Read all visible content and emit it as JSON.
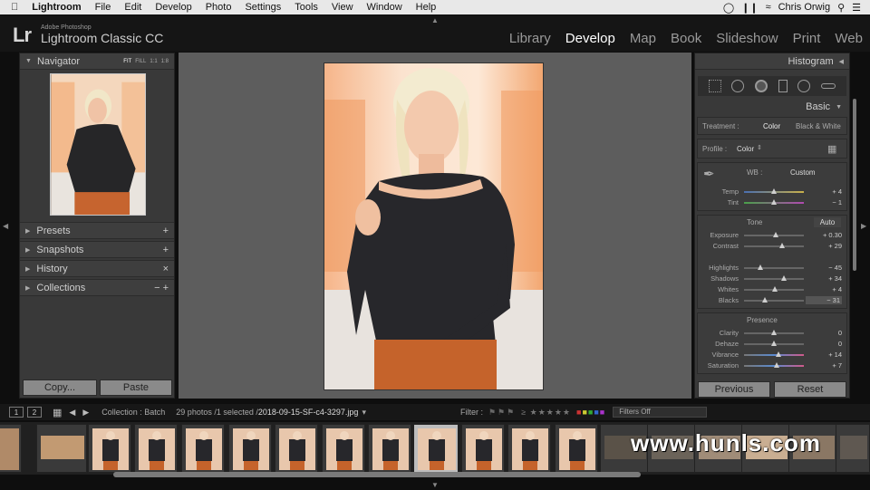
{
  "menubar": {
    "apple": "",
    "app_name": "Lightroom",
    "items": [
      "File",
      "Edit",
      "Develop",
      "Photo",
      "Settings",
      "Tools",
      "View",
      "Window",
      "Help"
    ],
    "user": "Chris Orwig"
  },
  "identity": {
    "logo": "Lr",
    "company": "Adobe Photoshop",
    "product": "Lightroom Classic CC",
    "modules": [
      "Library",
      "Develop",
      "Map",
      "Book",
      "Slideshow",
      "Print",
      "Web"
    ],
    "active_module": "Develop"
  },
  "left_panel": {
    "navigator": {
      "title": "Navigator",
      "zoom_options": [
        "FIT",
        "FILL",
        "1:1",
        "1:8"
      ],
      "active_zoom": "FIT"
    },
    "sections": [
      {
        "label": "Presets",
        "action": "+"
      },
      {
        "label": "Snapshots",
        "action": "+"
      },
      {
        "label": "History",
        "action": "×"
      },
      {
        "label": "Collections",
        "action": "−  +"
      }
    ],
    "copy_button": "Copy...",
    "paste_button": "Paste"
  },
  "right_panel": {
    "histogram_title": "Histogram",
    "basic_title": "Basic",
    "treatment_label": "Treatment :",
    "treatment_color": "Color",
    "treatment_bw": "Black & White",
    "profile_label": "Profile :",
    "profile_value": "Color",
    "wb_label": "WB :",
    "wb_value": "Custom",
    "tone_label": "Tone",
    "auto_label": "Auto",
    "presence_label": "Presence",
    "sliders": [
      {
        "label": "Temp",
        "value": "+ 4",
        "pos": 0.5
      },
      {
        "label": "Tint",
        "value": "− 1",
        "pos": 0.5
      },
      {
        "label": "Exposure",
        "value": "+ 0.30",
        "pos": 0.53
      },
      {
        "label": "Contrast",
        "value": "+ 29",
        "pos": 0.64
      },
      {
        "label": "Highlights",
        "value": "− 45",
        "pos": 0.28
      },
      {
        "label": "Shadows",
        "value": "+ 34",
        "pos": 0.67
      },
      {
        "label": "Whites",
        "value": "+ 4",
        "pos": 0.52
      },
      {
        "label": "Blacks",
        "value": "− 31",
        "pos": 0.35
      },
      {
        "label": "Clarity",
        "value": "0",
        "pos": 0.5
      },
      {
        "label": "Dehaze",
        "value": "0",
        "pos": 0.5
      },
      {
        "label": "Vibrance",
        "value": "+ 14",
        "pos": 0.57
      },
      {
        "label": "Saturation",
        "value": "+ 7",
        "pos": 0.54
      }
    ],
    "previous_button": "Previous",
    "reset_button": "Reset"
  },
  "filmstrip": {
    "page1": "1",
    "page2": "2",
    "source": "Collection : Batch",
    "count": "29 photos /1 selected /",
    "filename": "2018-09-15-SF-c4-3297.jpg",
    "filter_label": "Filter :",
    "filters_off": "Filters Off"
  },
  "watermark": "www.hunls.com",
  "colors": {
    "accent": "#ffffff",
    "panel": "#393939",
    "center": "#5d5d5d"
  }
}
